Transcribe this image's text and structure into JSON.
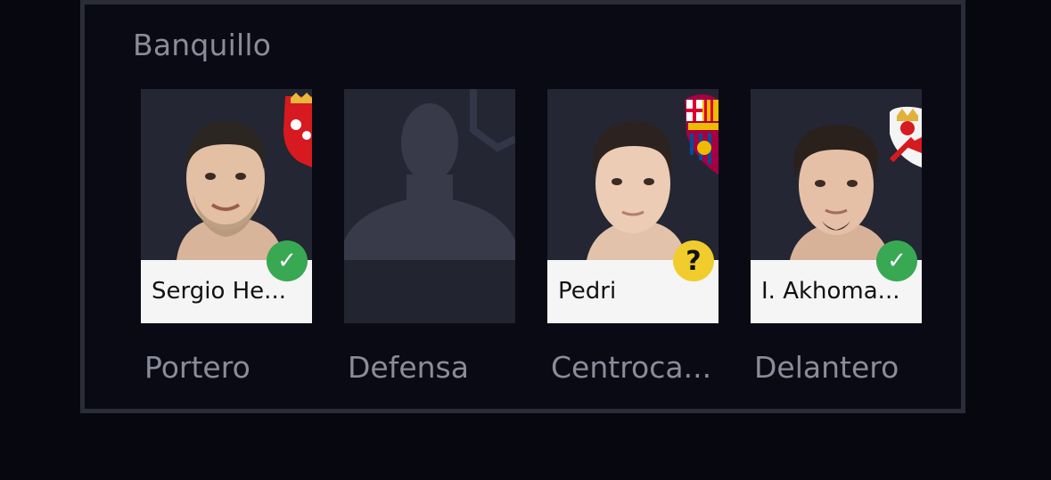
{
  "bench": {
    "title": "Banquillo",
    "slots": [
      {
        "player_name": "Sergio He...",
        "position": "Portero",
        "status": "confirmed",
        "status_icon": "check-icon",
        "status_glyph": "✓",
        "team_crest": "osasuna-crest-icon"
      },
      {
        "player_name": "",
        "position": "Defensa",
        "status": "empty",
        "team_crest": ""
      },
      {
        "player_name": "Pedri",
        "position": "Centroca...",
        "status": "doubtful",
        "status_icon": "question-icon",
        "status_glyph": "?",
        "team_crest": "barcelona-crest-icon"
      },
      {
        "player_name": "I. Akhoma...",
        "position": "Delantero",
        "status": "confirmed",
        "status_icon": "check-icon",
        "status_glyph": "✓",
        "team_crest": "rayo-vallecano-crest-icon"
      }
    ]
  },
  "colors": {
    "background": "#07070f",
    "card": "#22242f",
    "confirmed": "#38a852",
    "doubtful": "#f0cd2d",
    "label": "#8a8c9a"
  }
}
